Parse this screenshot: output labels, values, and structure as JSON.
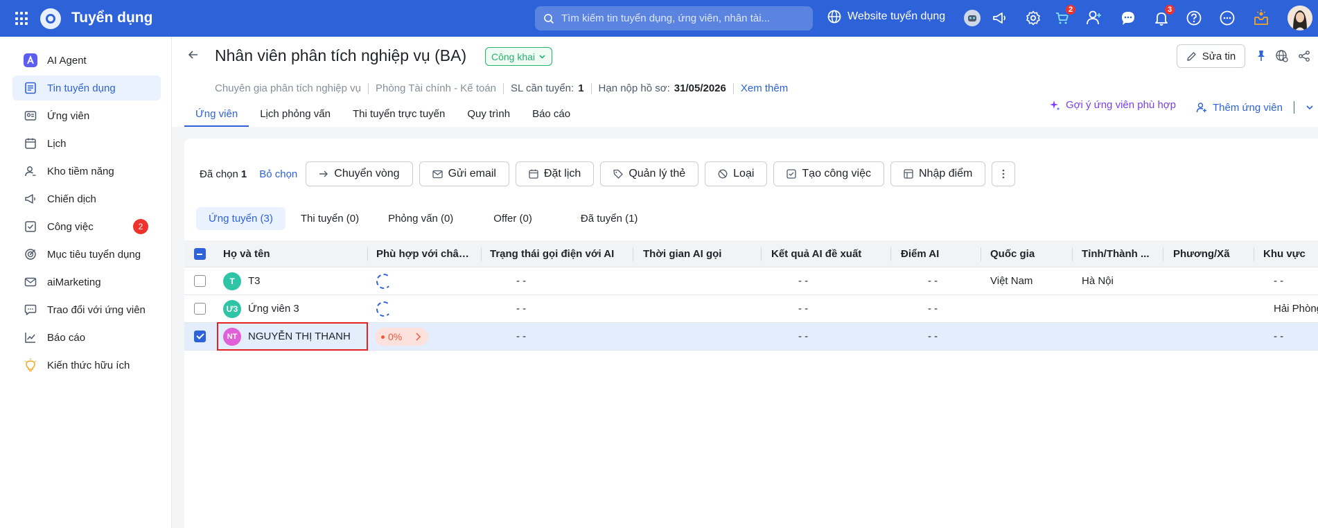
{
  "topbar": {
    "brand": "Tuyển dụng",
    "search_placeholder": "Tìm kiếm tin tuyển dụng, ứng viên, nhân tài...",
    "website_link": "Website tuyển dụng",
    "cart_badge": "2",
    "notification_badge": "3",
    "accent": "#2e62d9"
  },
  "sidebar": {
    "items": [
      {
        "label": "AI Agent",
        "icon": "ai-agent-icon"
      },
      {
        "label": "Tin tuyển dụng",
        "icon": "job-post-icon",
        "active": true
      },
      {
        "label": "Ứng viên",
        "icon": "candidate-icon"
      },
      {
        "label": "Lịch",
        "icon": "calendar-icon"
      },
      {
        "label": "Kho tiềm năng",
        "icon": "talent-pool-icon"
      },
      {
        "label": "Chiến dịch",
        "icon": "megaphone-icon"
      },
      {
        "label": "Công việc",
        "icon": "task-icon",
        "badge": "2"
      },
      {
        "label": "Mục tiêu tuyển dụng",
        "icon": "target-icon"
      },
      {
        "label": "aiMarketing",
        "icon": "mail-icon"
      },
      {
        "label": "Trao đổi với ứng viên",
        "icon": "chat-icon"
      },
      {
        "label": "Báo cáo",
        "icon": "chart-icon"
      },
      {
        "label": "Kiến thức hữu ích",
        "icon": "bulb-icon"
      }
    ]
  },
  "job": {
    "title": "Nhân viên phân tích nghiệp vụ (BA)",
    "status": "Công khai",
    "position": "Chuyên gia phân tích nghiệp vụ",
    "department": "Phòng Tài chính - Kế toán",
    "quota_label": "SL cần tuyển:",
    "quota_value": "1",
    "deadline_label": "Hạn nộp hồ sơ:",
    "deadline_value": "31/05/2026",
    "more_link": "Xem thêm",
    "edit_label": "Sửa tin"
  },
  "tabs": [
    {
      "label": "Ứng viên",
      "active": true
    },
    {
      "label": "Lịch phỏng vấn"
    },
    {
      "label": "Thi tuyển trực tuyến"
    },
    {
      "label": "Quy trình"
    },
    {
      "label": "Báo cáo"
    }
  ],
  "actions": {
    "suggest": "Gợi ý ứng viên phù hợp",
    "add_candidate": "Thêm ứng viên"
  },
  "toolbar": {
    "selected_label": "Đã chọn",
    "selected_count": "1",
    "unselect": "Bỏ chọn",
    "buttons": [
      {
        "label": "Chuyển vòng",
        "icon": "arrow-right-icon"
      },
      {
        "label": "Gửi email",
        "icon": "mail-icon"
      },
      {
        "label": "Đặt lịch",
        "icon": "calendar-icon"
      },
      {
        "label": "Quản lý thẻ",
        "icon": "tag-icon"
      },
      {
        "label": "Loại",
        "icon": "ban-icon"
      },
      {
        "label": "Tạo công việc",
        "icon": "checkbox-icon"
      },
      {
        "label": "Nhập điểm",
        "icon": "grid-icon"
      }
    ]
  },
  "stages": [
    {
      "label": "Ứng tuyển (3)",
      "active": true
    },
    {
      "label": "Thi tuyển (0)"
    },
    {
      "label": "Phỏng vấn (0)"
    },
    {
      "label": "Offer (0)"
    },
    {
      "label": "Đã tuyển (1)"
    }
  ],
  "table": {
    "columns": [
      "Họ và tên",
      "Phù hợp với chân ...",
      "Trạng thái gọi điện với AI",
      "Thời gian AI gọi",
      "Kết quả AI đề xuất",
      "Điểm AI",
      "Quốc gia",
      "Tỉnh/Thành ...",
      "Phương/Xã",
      "Khu vực"
    ],
    "rows": [
      {
        "initials": "T",
        "avatar_color": "#2ec4a5",
        "name": "T3",
        "match": "loading",
        "call_status": "- -",
        "call_time": "",
        "ai_result": "- -",
        "ai_score": "- -",
        "country": "Việt Nam",
        "province": "Hà Nội",
        "ward": "",
        "region": "- -",
        "checked": false
      },
      {
        "initials": "Ư3",
        "avatar_color": "#2ec4a5",
        "name": "Ứng viên 3",
        "match": "loading",
        "call_status": "- -",
        "call_time": "",
        "ai_result": "- -",
        "ai_score": "- -",
        "country": "",
        "province": "",
        "ward": "",
        "region": "Hải Phòng",
        "checked": false
      },
      {
        "initials": "NT",
        "avatar_color": "#e060d8",
        "name": "NGUYỄN THỊ THANH",
        "match": "0%",
        "call_status": "- -",
        "call_time": "",
        "ai_result": "- -",
        "ai_score": "- -",
        "country": "",
        "province": "",
        "ward": "",
        "region": "- -",
        "checked": true
      }
    ]
  }
}
